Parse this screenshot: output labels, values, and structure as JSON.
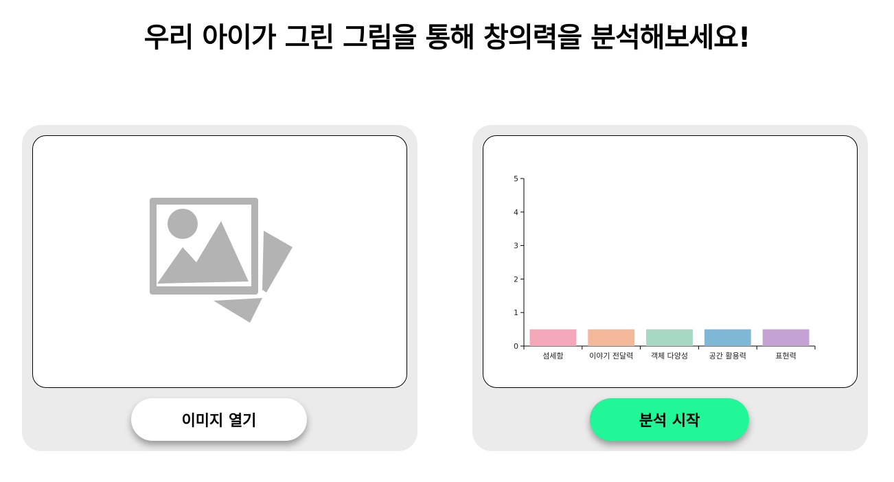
{
  "header": {
    "title": "우리 아이가 그린 그림을 통해 창의력을 분석해보세요!"
  },
  "image_panel": {
    "placeholder_icon": "image-placeholder-icon",
    "open_button_label": "이미지 열기"
  },
  "analysis_panel": {
    "start_button_label": "분석 시작",
    "start_button_color": "#22f797"
  },
  "chart_data": {
    "type": "bar",
    "categories": [
      "섬세함",
      "이야기 전달력",
      "객체 다양성",
      "공간 활용력",
      "표현력"
    ],
    "values": [
      0.5,
      0.5,
      0.5,
      0.5,
      0.5
    ],
    "colors": [
      "#f4a7b9",
      "#f2b899",
      "#a8d8c4",
      "#7fb8d6",
      "#c4a2d4"
    ],
    "yticks": [
      0,
      1,
      2,
      3,
      4,
      5
    ],
    "ylim": [
      0,
      5
    ],
    "title": "",
    "xlabel": "",
    "ylabel": ""
  }
}
